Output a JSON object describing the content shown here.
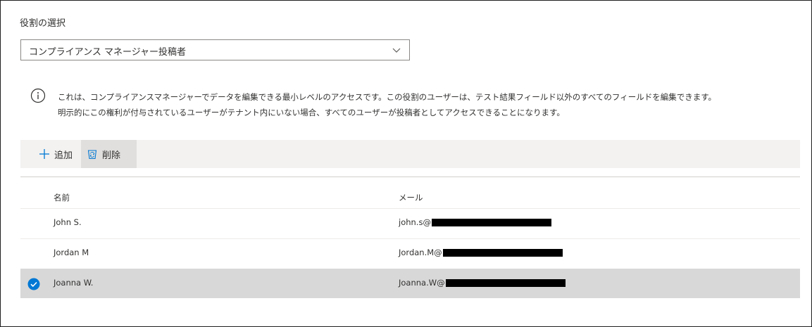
{
  "role_section": {
    "label": "役割の選択",
    "selected_role": "コンプライアンス マネージャー投稿者"
  },
  "info": {
    "line1": "これは、コンプライアンスマネージャーでデータを編集できる最小レベルのアクセスです。この役割のユーザーは、テスト結果フィールド以外のすべてのフィールドを編集できます。",
    "line2": "明示的にこの権利が付与されているユーザーがテナント内にいない場合、すべてのユーザーが投稿者としてアクセスできることになります。"
  },
  "toolbar": {
    "add_label": "追加",
    "delete_label": "削除"
  },
  "table": {
    "columns": {
      "name": "名前",
      "email": "メール"
    },
    "rows": [
      {
        "name": "John S.",
        "email_prefix": "john.s@",
        "selected": false
      },
      {
        "name": "Jordan M",
        "email_prefix": "Jordan.M@",
        "selected": false
      },
      {
        "name": "Joanna W.",
        "email_prefix": "Joanna.W@",
        "selected": true
      }
    ]
  },
  "colors": {
    "accent": "#0078d4",
    "selected_row": "#d8d8d8",
    "toolbar_bg": "#f3f2f1"
  },
  "icons": {
    "add": "add-icon",
    "delete": "recycle-bin-icon",
    "info": "info-icon",
    "dropdown": "chevron-down-icon",
    "selected": "checkmark-circle-icon"
  }
}
